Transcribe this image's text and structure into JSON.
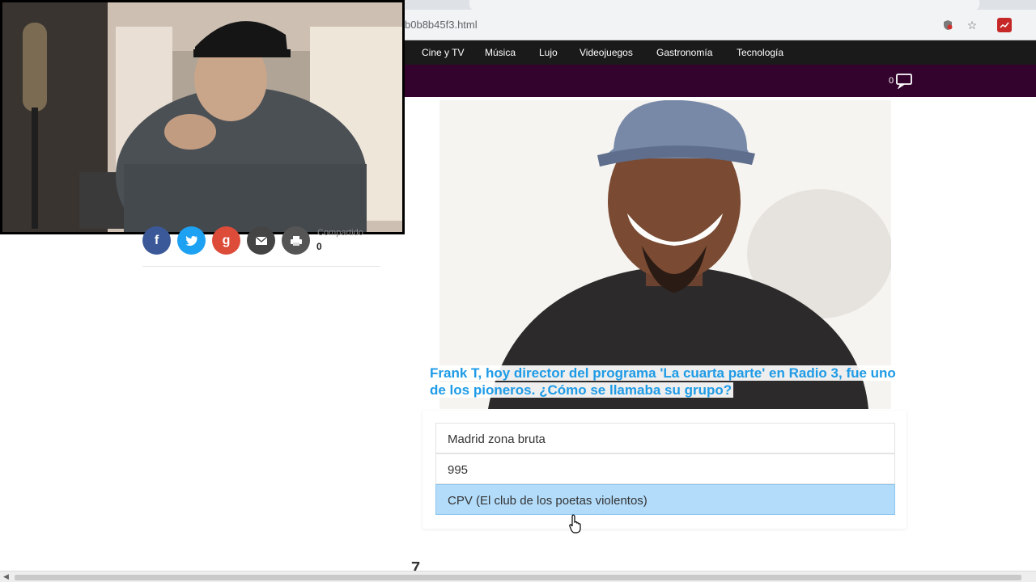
{
  "browser": {
    "url_fragment": "b0b8b45f3.html",
    "icons": [
      "shield-icon",
      "star-icon",
      "extension-icon"
    ]
  },
  "site_nav": {
    "items": [
      "Cine y TV",
      "Música",
      "Lujo",
      "Videojuegos",
      "Gastronomía",
      "Tecnología"
    ],
    "comment_count": "0"
  },
  "share": {
    "buttons": [
      "facebook",
      "twitter",
      "google-plus",
      "email",
      "print"
    ],
    "count_label": "Compartido",
    "count": "0",
    "colors": {
      "facebook": "#3b5998",
      "twitter": "#1da1f2",
      "google-plus": "#dd4b39",
      "email": "#444444",
      "print": "#555555"
    }
  },
  "quiz": {
    "question": "Frank T, hoy director del programa 'La cuarta parte' en Radio 3, fue uno de los pioneros. ¿Cómo se llamaba su grupo?",
    "answers": [
      {
        "text": "Madrid zona bruta",
        "selected": false
      },
      {
        "text": "995",
        "selected": false
      },
      {
        "text": "CPV (El club de los poetas violentos)",
        "selected": true
      }
    ],
    "next_number": "7"
  },
  "colors": {
    "nav_bg": "#1a1a1a",
    "subbar_bg": "#33032e",
    "question_text": "#1e9be6",
    "selected_answer": "#b3dcfa"
  }
}
